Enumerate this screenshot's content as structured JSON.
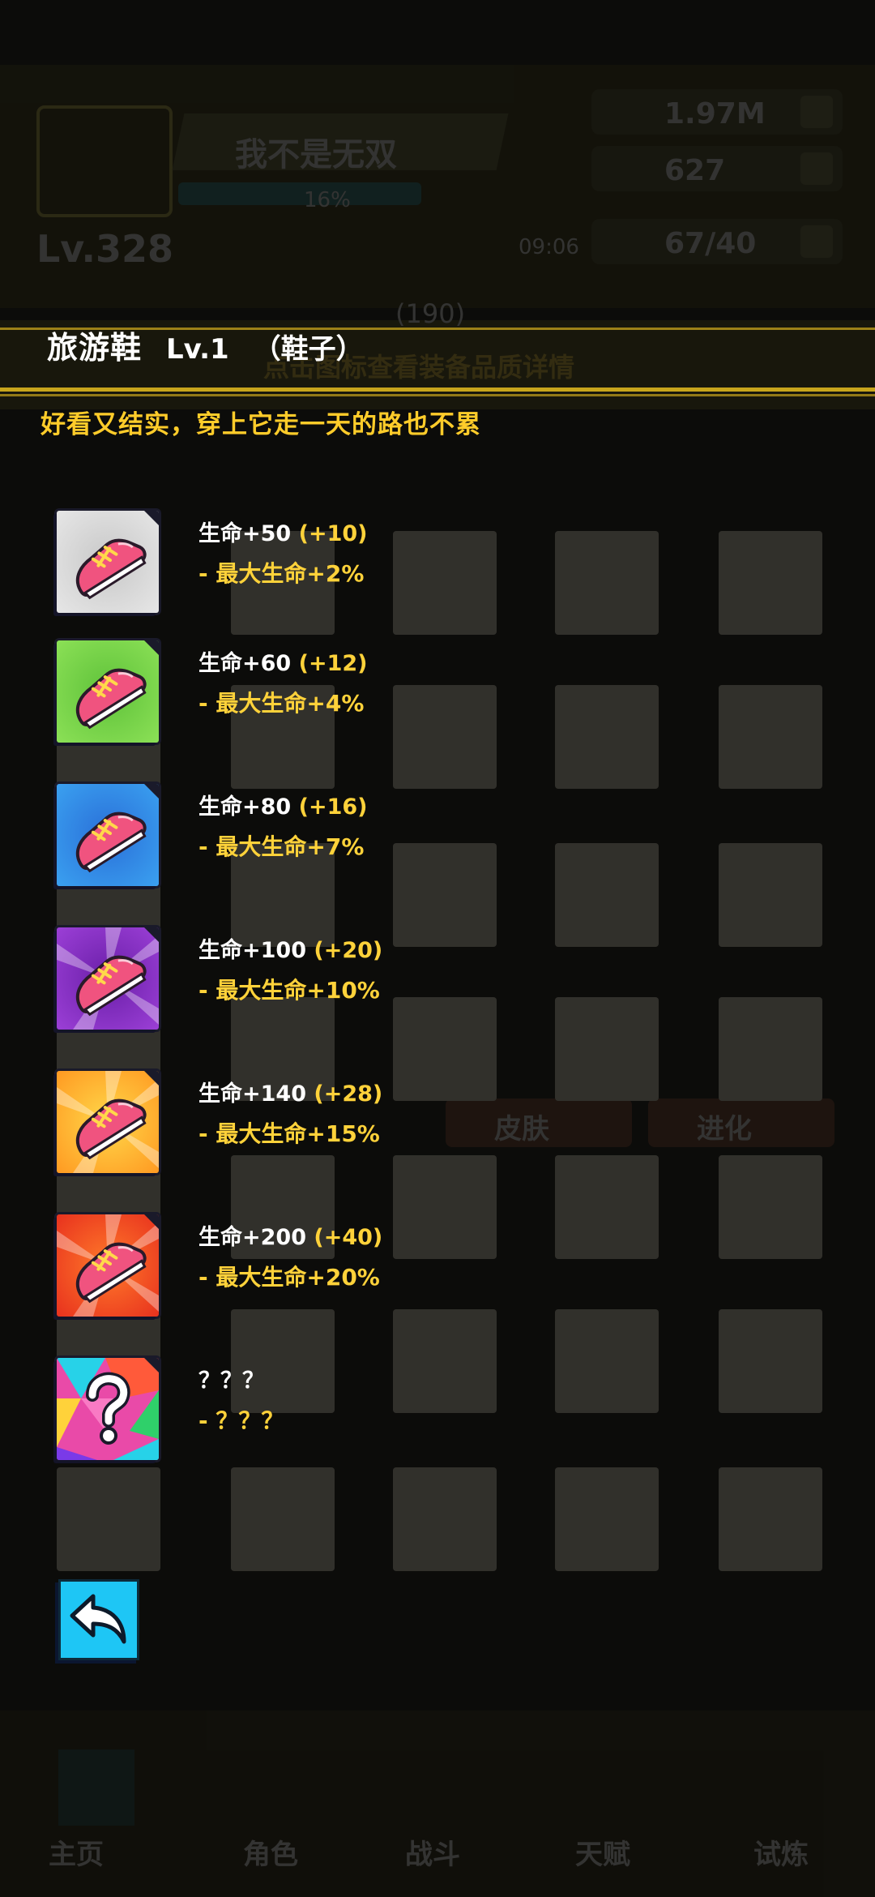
{
  "background": {
    "player_name": "我不是无双",
    "exp_percent": "16%",
    "level": "Lv.328",
    "timer": "09:06",
    "resources": [
      "1.97M",
      "627",
      "67/40"
    ],
    "hint": "点击图标查看装备品质详情",
    "count": "(190)",
    "tabs": [
      "皮肤",
      "进化"
    ],
    "nav": [
      "主页",
      "角色",
      "战斗",
      "天赋",
      "试炼"
    ]
  },
  "item": {
    "name": "旅游鞋",
    "level": "Lv.1",
    "type": "（鞋子）",
    "description": "好看又结实，穿上它走一天的路也不累"
  },
  "tiers": [
    {
      "grade": "white",
      "line1_base": "生命+50 ",
      "line1_bonus": "(+10)",
      "line2": "- 最大生命+2%"
    },
    {
      "grade": "green",
      "line1_base": "生命+60 ",
      "line1_bonus": "(+12)",
      "line2": "- 最大生命+4%"
    },
    {
      "grade": "blue",
      "line1_base": "生命+80 ",
      "line1_bonus": "(+16)",
      "line2": "- 最大生命+7%"
    },
    {
      "grade": "purple",
      "line1_base": "生命+100 ",
      "line1_bonus": "(+20)",
      "line2": "- 最大生命+10%"
    },
    {
      "grade": "orange",
      "line1_base": "生命+140 ",
      "line1_bonus": "(+28)",
      "line2": "- 最大生命+15%"
    },
    {
      "grade": "red",
      "line1_base": "生命+200 ",
      "line1_bonus": "(+40)",
      "line2": "- 最大生命+20%"
    },
    {
      "grade": "rainbow",
      "line1_base": "？？？",
      "line1_bonus": "",
      "line2": "- ？？？"
    }
  ],
  "colors": {
    "accent_gold": "#ffd23a",
    "grade_white": "#e6e6e6",
    "grade_green": "#8be056",
    "grade_blue": "#3aa0f0",
    "grade_purple": "#9b3fd6",
    "grade_orange": "#ff9a22",
    "grade_red": "#e8321e"
  },
  "icons": {
    "tier_icon": "pink-sneaker-icon",
    "locked_icon": "question-mark-icon",
    "back": "back-arrow-icon"
  }
}
